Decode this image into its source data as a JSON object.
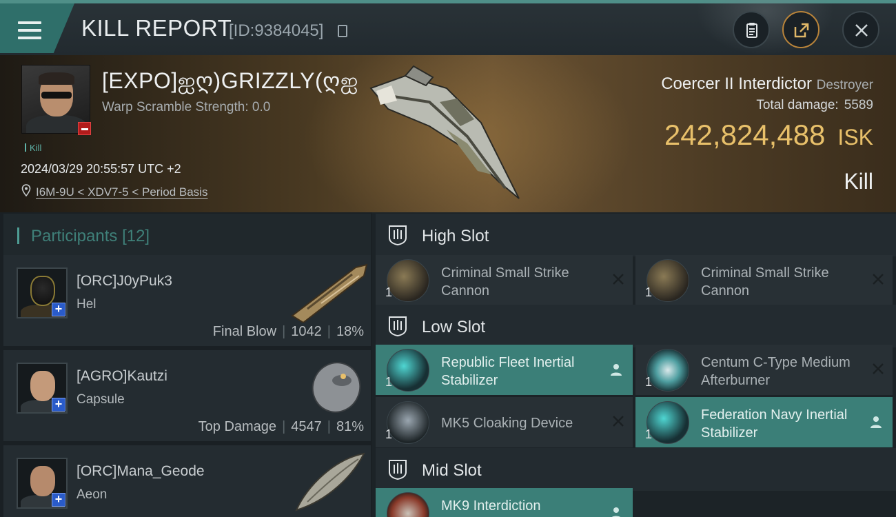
{
  "header": {
    "title": "KILL REPORT",
    "report_id": "[ID:9384045]"
  },
  "victim": {
    "name": "[EXPO]ஐღ)GRIZZLY(ღஐ",
    "warp_scramble": "Warp Scramble Strength: 0.0",
    "tag": "Kill",
    "datetime": "2024/03/29 20:55:57 UTC +2",
    "location": "I6M-9U < XDV7-5 < Period Basis"
  },
  "ship": {
    "name": "Coercer II Interdictor",
    "class": "Destroyer",
    "total_damage_label": "Total damage:",
    "total_damage": "5589",
    "isk_value": "242,824,488",
    "isk_unit": "ISK",
    "result": "Kill"
  },
  "participants": {
    "title": "Participants",
    "count": "[12]",
    "items": [
      {
        "name": "[ORC]J0yPuk3",
        "ship": "Hel",
        "role": "Final Blow",
        "damage": "1042",
        "percent": "18%"
      },
      {
        "name": "[AGRO]Kautzi",
        "ship": "Capsule",
        "role": "Top Damage",
        "damage": "4547",
        "percent": "81%"
      },
      {
        "name": "[ORC]Mana_Geode",
        "ship": "Aeon"
      }
    ]
  },
  "slots": {
    "high": {
      "label": "High Slot",
      "modules": [
        {
          "name": "Criminal Small Strike Cannon",
          "qty": "1",
          "state": "destroyed"
        },
        {
          "name": "Criminal Small Strike Cannon",
          "qty": "1",
          "state": "destroyed"
        }
      ]
    },
    "low": {
      "label": "Low Slot",
      "modules": [
        {
          "name": "Republic Fleet Inertial Stabilizer",
          "qty": "1",
          "state": "dropped"
        },
        {
          "name": "Centum C-Type Medium Afterburner",
          "qty": "1",
          "state": "destroyed"
        },
        {
          "name": "MK5 Cloaking Device",
          "qty": "1",
          "state": "destroyed"
        },
        {
          "name": "Federation Navy Inertial Stabilizer",
          "qty": "1",
          "state": "dropped"
        }
      ]
    },
    "mid": {
      "label": "Mid Slot",
      "modules": [
        {
          "name": "MK9 Interdiction",
          "qty": "1",
          "state": "dropped"
        }
      ]
    }
  },
  "colors": {
    "accent": "#3b7f78",
    "isk": "#e8c06a",
    "header_topline": "#4f8f88"
  }
}
